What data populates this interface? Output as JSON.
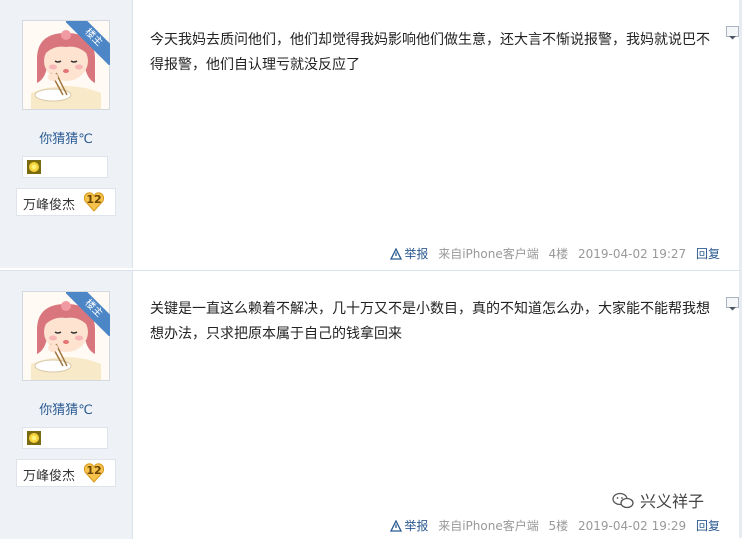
{
  "posts": [
    {
      "role_badge": "楼主",
      "username": "你猜猜℃",
      "level_title": "万峰俊杰",
      "level_number": "12",
      "content": "今天我妈去质问他们，他们却觉得我妈影响他们做生意，还大言不惭说报警，我妈就说巴不得报警，他们自认理亏就没反应了",
      "report_label": "举报",
      "source": "来自iPhone客户端",
      "floor": "4楼",
      "timestamp": "2019-04-02 19:27",
      "reply_label": "回复"
    },
    {
      "role_badge": "楼主",
      "username": "你猜猜℃",
      "level_title": "万峰俊杰",
      "level_number": "12",
      "content": "关键是一直这么赖着不解决，几十万又不是小数目，真的不知道怎么办，大家能不能帮我想想办法，只求把原本属于自己的钱拿回来",
      "report_label": "举报",
      "source": "来自iPhone客户端",
      "floor": "5楼",
      "timestamp": "2019-04-02 19:29",
      "reply_label": "回复"
    }
  ],
  "watermark": {
    "text": "兴义祥子",
    "icon": "wechat-icon"
  },
  "icons": {
    "report": "warning-triangle-icon",
    "medal": "sun-medal-icon",
    "level": "heart-badge-icon",
    "menu": "chevron-down-icon"
  },
  "colors": {
    "sidebar_bg": "#eef2f7",
    "ribbon": "#4c86c6",
    "link": "#2a5a92",
    "meta": "#999999"
  }
}
